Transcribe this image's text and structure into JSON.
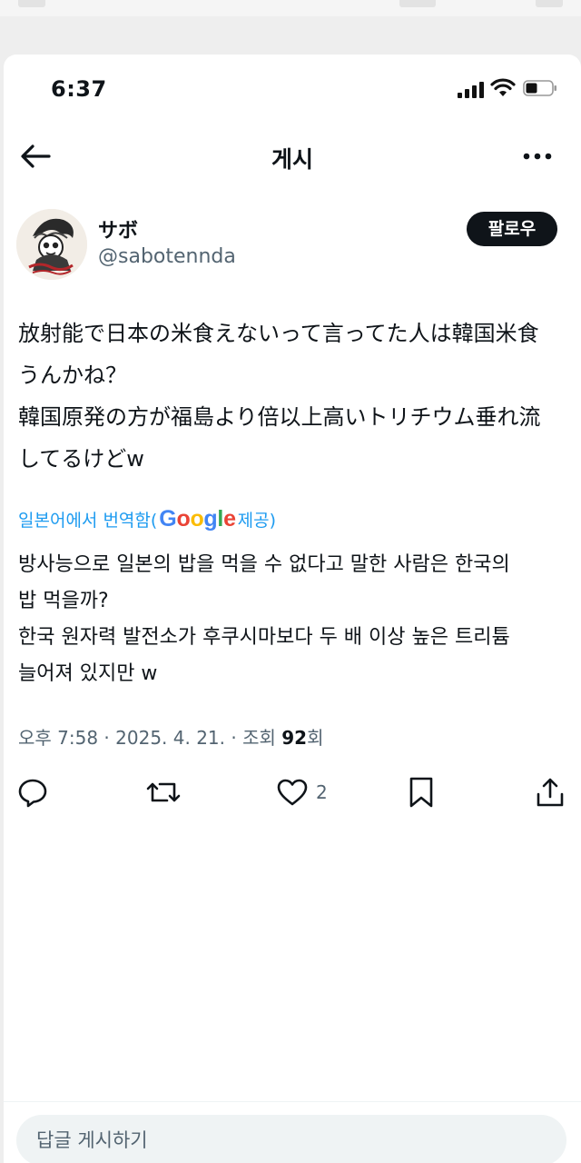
{
  "status_bar": {
    "time": "6:37"
  },
  "nav": {
    "title": "게시"
  },
  "author": {
    "display_name": "サボ",
    "handle": "@sabotennda"
  },
  "follow_label": "팔로우",
  "tweet": {
    "text": "放射能で日本の米食えないって言ってた人は韓国米食\nうんかね？\n韓国原発の方が福島より倍以上高いトリチウム垂れ流\nしてるけどw"
  },
  "translation": {
    "prefix": "일본어에서 번역함(",
    "provider": "Google",
    "suffix": " 제공)",
    "text": "방사능으로 일본의 밥을 먹을 수 없다고 말한 사람은 한국의\n밥 먹을까?\n한국 원자력 발전소가 후쿠시마보다 두 배 이상 높은 트리튬\n늘어져 있지만 w"
  },
  "meta": {
    "time": "오후 7:58",
    "separator": " · ",
    "date": "2025. 4. 21.",
    "views_prefix": "조회 ",
    "views_count": "92",
    "views_suffix": "회"
  },
  "actions": {
    "reply_icon": "reply-icon",
    "repost_icon": "repost-icon",
    "like_icon": "heart-icon",
    "like_count": "2",
    "bookmark_icon": "bookmark-icon",
    "share_icon": "share-icon"
  },
  "reply_box": {
    "placeholder": "답글 게시하기"
  },
  "colors": {
    "accent": "#1d9bf0",
    "text": "#0f1419",
    "muted": "#536471",
    "follow_bg": "#0f1419",
    "google_blue": "#4285f4",
    "google_red": "#ea4335",
    "google_yellow": "#fbbc05",
    "google_green": "#34a853"
  }
}
